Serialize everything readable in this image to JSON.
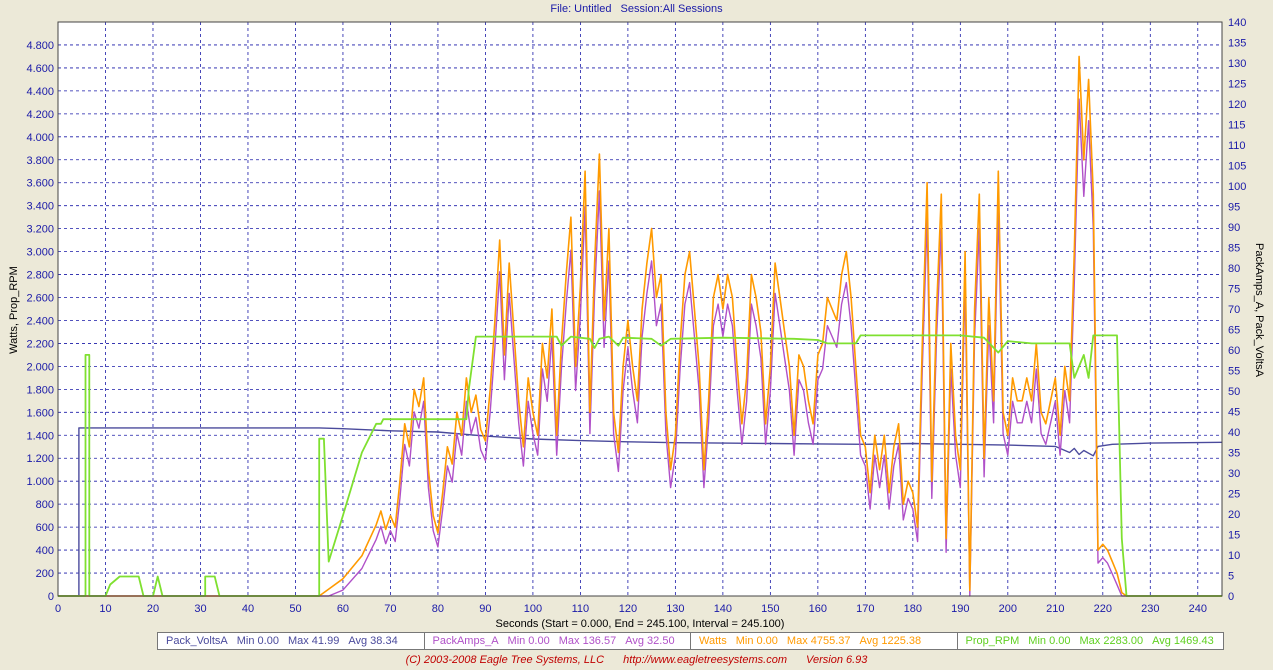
{
  "header": {
    "file": "File: Untitled",
    "session": "Session:All Sessions"
  },
  "chart_data": {
    "type": "line",
    "xlabel": "Seconds (Start = 0.000,  End = 245.100,  Interval =  245.100)",
    "ylabel_left": "Watts, Prop_RPM",
    "ylabel_right": "PackAmps_A, Pack_VoltsA",
    "xlim": [
      0,
      245.1
    ],
    "ylim_left": [
      0,
      5000
    ],
    "ylim_right": [
      0,
      140
    ],
    "x_ticks": [
      "0",
      "10",
      "20",
      "30",
      "40",
      "50",
      "60",
      "70",
      "80",
      "90",
      "100",
      "110",
      "120",
      "130",
      "140",
      "150",
      "160",
      "170",
      "180",
      "190",
      "200",
      "210",
      "220",
      "230",
      "240"
    ],
    "y_left_ticks": [
      "0",
      "200",
      "400",
      "600",
      "800",
      "1.000",
      "1.200",
      "1.400",
      "1.600",
      "1.800",
      "2.000",
      "2.200",
      "2.400",
      "2.600",
      "2.800",
      "3.000",
      "3.200",
      "3.400",
      "3.600",
      "3.800",
      "4.000",
      "4.200",
      "4.400",
      "4.600",
      "4.800"
    ],
    "y_right_ticks": [
      "0",
      "5",
      "10",
      "15",
      "20",
      "25",
      "30",
      "35",
      "40",
      "45",
      "50",
      "55",
      "60",
      "65",
      "70",
      "75",
      "80",
      "85",
      "90",
      "95",
      "100",
      "105",
      "110",
      "115",
      "120",
      "125",
      "130",
      "135",
      "140"
    ],
    "grid": true,
    "colors": {
      "volts": "#4a4a9c",
      "amps": "#b050c8",
      "watts": "#ff9a00",
      "rpm": "#7fe030",
      "grid": "#1a1aa8",
      "axis_text": "#1a1aa8"
    },
    "series": [
      {
        "name": "Pack_VoltsA",
        "axis": "right",
        "stats": {
          "min": "Min 0.00",
          "max": "Max 41.99",
          "avg": "Avg 38.34"
        },
        "points": [
          [
            0,
            0
          ],
          [
            4.4,
            0
          ],
          [
            4.4,
            41
          ],
          [
            55,
            41
          ],
          [
            60,
            40.8
          ],
          [
            70,
            40.3
          ],
          [
            80,
            40
          ],
          [
            90,
            39
          ],
          [
            100,
            38.3
          ],
          [
            110,
            37.9
          ],
          [
            120,
            37.6
          ],
          [
            130,
            37.4
          ],
          [
            140,
            37.3
          ],
          [
            150,
            37.2
          ],
          [
            160,
            37.1
          ],
          [
            170,
            37
          ],
          [
            180,
            37.2
          ],
          [
            190,
            37
          ],
          [
            200,
            36.8
          ],
          [
            210,
            36.5
          ],
          [
            213,
            35
          ],
          [
            214,
            36
          ],
          [
            215,
            34.5
          ],
          [
            216,
            35.5
          ],
          [
            218,
            34.2
          ],
          [
            219,
            36.5
          ],
          [
            222,
            37
          ],
          [
            230,
            37.3
          ],
          [
            245.1,
            37.5
          ]
        ]
      },
      {
        "name": "PackAmps_A",
        "axis": "right",
        "stats": {
          "min": "Min 0.00",
          "max": "Max 136.57",
          "avg": "Avg 32.50"
        }
      },
      {
        "name": "Watts",
        "axis": "left",
        "stats": {
          "min": "Min 0.00",
          "max": "Max 4755.37",
          "avg": "Avg 1225.38"
        },
        "points": [
          [
            0,
            0
          ],
          [
            55,
            0
          ],
          [
            57,
            60
          ],
          [
            60,
            150
          ],
          [
            64,
            350
          ],
          [
            67,
            620
          ],
          [
            68,
            740
          ],
          [
            69,
            580
          ],
          [
            70,
            700
          ],
          [
            71,
            600
          ],
          [
            72,
            1000
          ],
          [
            73,
            1500
          ],
          [
            74,
            1300
          ],
          [
            75,
            1800
          ],
          [
            76,
            1650
          ],
          [
            77,
            1900
          ],
          [
            78,
            1100
          ],
          [
            79,
            700
          ],
          [
            80,
            550
          ],
          [
            81,
            900
          ],
          [
            82,
            1300
          ],
          [
            83,
            1150
          ],
          [
            84,
            1600
          ],
          [
            85,
            1400
          ],
          [
            86,
            1900
          ],
          [
            87,
            1600
          ],
          [
            88,
            1750
          ],
          [
            89,
            1450
          ],
          [
            90,
            1350
          ],
          [
            91,
            1800
          ],
          [
            92,
            2400
          ],
          [
            93,
            3100
          ],
          [
            94,
            2100
          ],
          [
            95,
            2900
          ],
          [
            96,
            2300
          ],
          [
            97,
            1700
          ],
          [
            98,
            1300
          ],
          [
            99,
            1900
          ],
          [
            100,
            1600
          ],
          [
            101,
            1400
          ],
          [
            102,
            2200
          ],
          [
            103,
            1900
          ],
          [
            104,
            2500
          ],
          [
            105,
            1400
          ],
          [
            106,
            2200
          ],
          [
            107,
            2800
          ],
          [
            108,
            3300
          ],
          [
            109,
            2000
          ],
          [
            110,
            2700
          ],
          [
            111,
            3700
          ],
          [
            112,
            1600
          ],
          [
            113,
            2900
          ],
          [
            114,
            3850
          ],
          [
            115,
            2400
          ],
          [
            116,
            3200
          ],
          [
            117,
            1600
          ],
          [
            118,
            1250
          ],
          [
            119,
            2000
          ],
          [
            120,
            2400
          ],
          [
            121,
            2000
          ],
          [
            122,
            1700
          ],
          [
            123,
            2500
          ],
          [
            124,
            2900
          ],
          [
            125,
            3200
          ],
          [
            126,
            2600
          ],
          [
            127,
            2800
          ],
          [
            128,
            1600
          ],
          [
            129,
            1100
          ],
          [
            130,
            1400
          ],
          [
            131,
            2200
          ],
          [
            132,
            2800
          ],
          [
            133,
            3000
          ],
          [
            134,
            2500
          ],
          [
            135,
            2000
          ],
          [
            136,
            1100
          ],
          [
            137,
            1700
          ],
          [
            138,
            2600
          ],
          [
            139,
            2800
          ],
          [
            140,
            2500
          ],
          [
            141,
            2800
          ],
          [
            142,
            2600
          ],
          [
            143,
            2000
          ],
          [
            144,
            1500
          ],
          [
            145,
            1900
          ],
          [
            146,
            2800
          ],
          [
            147,
            2600
          ],
          [
            148,
            2300
          ],
          [
            149,
            1500
          ],
          [
            150,
            2000
          ],
          [
            151,
            2900
          ],
          [
            152,
            2600
          ],
          [
            153,
            2300
          ],
          [
            154,
            2000
          ],
          [
            155,
            1400
          ],
          [
            156,
            2100
          ],
          [
            157,
            2000
          ],
          [
            158,
            1700
          ],
          [
            159,
            1500
          ],
          [
            160,
            2100
          ],
          [
            161,
            2200
          ],
          [
            162,
            2600
          ],
          [
            163,
            2500
          ],
          [
            164,
            2400
          ],
          [
            165,
            2800
          ],
          [
            166,
            3000
          ],
          [
            167,
            2600
          ],
          [
            168,
            2000
          ],
          [
            169,
            1400
          ],
          [
            170,
            1300
          ],
          [
            171,
            900
          ],
          [
            172,
            1400
          ],
          [
            173,
            1100
          ],
          [
            174,
            1400
          ],
          [
            175,
            900
          ],
          [
            176,
            1300
          ],
          [
            177,
            1500
          ],
          [
            178,
            800
          ],
          [
            179,
            1000
          ],
          [
            180,
            900
          ],
          [
            181,
            600
          ],
          [
            182,
            2200
          ],
          [
            183,
            3600
          ],
          [
            184,
            1000
          ],
          [
            185,
            2500
          ],
          [
            186,
            3500
          ],
          [
            187,
            500
          ],
          [
            188,
            2200
          ],
          [
            189,
            1400
          ],
          [
            190,
            1100
          ],
          [
            191,
            3000
          ],
          [
            192,
            50
          ],
          [
            193,
            2500
          ],
          [
            194,
            3500
          ],
          [
            195,
            1200
          ],
          [
            196,
            2600
          ],
          [
            197,
            1700
          ],
          [
            198,
            3700
          ],
          [
            199,
            1600
          ],
          [
            200,
            1400
          ],
          [
            201,
            1900
          ],
          [
            202,
            1700
          ],
          [
            203,
            1700
          ],
          [
            204,
            1900
          ],
          [
            205,
            1700
          ],
          [
            206,
            2200
          ],
          [
            207,
            1600
          ],
          [
            208,
            1500
          ],
          [
            209,
            1700
          ],
          [
            210,
            1900
          ],
          [
            211,
            1400
          ],
          [
            212,
            2000
          ],
          [
            213,
            1700
          ],
          [
            214,
            3000
          ],
          [
            215,
            4700
          ],
          [
            216,
            3800
          ],
          [
            217,
            4500
          ],
          [
            218,
            3500
          ],
          [
            219,
            400
          ],
          [
            220,
            450
          ],
          [
            221,
            400
          ],
          [
            222,
            300
          ],
          [
            223,
            200
          ],
          [
            224,
            30
          ],
          [
            225,
            0
          ],
          [
            245.1,
            0
          ]
        ]
      },
      {
        "name": "Prop_RPM",
        "axis": "left",
        "stats": {
          "min": "Min 0.00",
          "max": "Max 2283.00",
          "avg": "Avg 1469.43"
        },
        "points": [
          [
            0,
            0
          ],
          [
            5.8,
            0
          ],
          [
            5.8,
            2100
          ],
          [
            6.6,
            2100
          ],
          [
            6.6,
            0
          ],
          [
            10,
            0
          ],
          [
            11,
            100
          ],
          [
            13,
            170
          ],
          [
            17,
            170
          ],
          [
            18,
            0
          ],
          [
            20,
            0
          ],
          [
            21,
            170
          ],
          [
            22,
            0
          ],
          [
            31,
            0
          ],
          [
            31,
            170
          ],
          [
            33,
            170
          ],
          [
            34,
            0
          ],
          [
            55,
            0
          ],
          [
            55,
            1370
          ],
          [
            56,
            1370
          ],
          [
            57,
            300
          ],
          [
            60,
            700
          ],
          [
            64,
            1250
          ],
          [
            67,
            1500
          ],
          [
            68,
            1500
          ],
          [
            68.5,
            1540
          ],
          [
            86,
            1540
          ],
          [
            86.5,
            1800
          ],
          [
            88,
            2260
          ],
          [
            105,
            2260
          ],
          [
            106,
            2180
          ],
          [
            108,
            2260
          ],
          [
            112,
            2240
          ],
          [
            113,
            2160
          ],
          [
            114,
            2240
          ],
          [
            116,
            2260
          ],
          [
            118,
            2180
          ],
          [
            119,
            2250
          ],
          [
            125,
            2240
          ],
          [
            127,
            2180
          ],
          [
            129,
            2240
          ],
          [
            140,
            2250
          ],
          [
            155,
            2240
          ],
          [
            160,
            2230
          ],
          [
            162,
            2200
          ],
          [
            168,
            2200
          ],
          [
            169,
            2270
          ],
          [
            190,
            2270
          ],
          [
            195,
            2250
          ],
          [
            198,
            2120
          ],
          [
            200,
            2220
          ],
          [
            205,
            2200
          ],
          [
            213,
            2200
          ],
          [
            214,
            1900
          ],
          [
            216,
            2100
          ],
          [
            217,
            1900
          ],
          [
            218,
            2270
          ],
          [
            223,
            2270
          ],
          [
            224,
            500
          ],
          [
            225,
            0
          ],
          [
            245.1,
            0
          ]
        ]
      }
    ]
  },
  "footer": {
    "copyright": "(C) 2003-2008 Eagle Tree Systems, LLC",
    "url": "http://www.eagletreesystems.com",
    "version": "Version 6.93"
  }
}
